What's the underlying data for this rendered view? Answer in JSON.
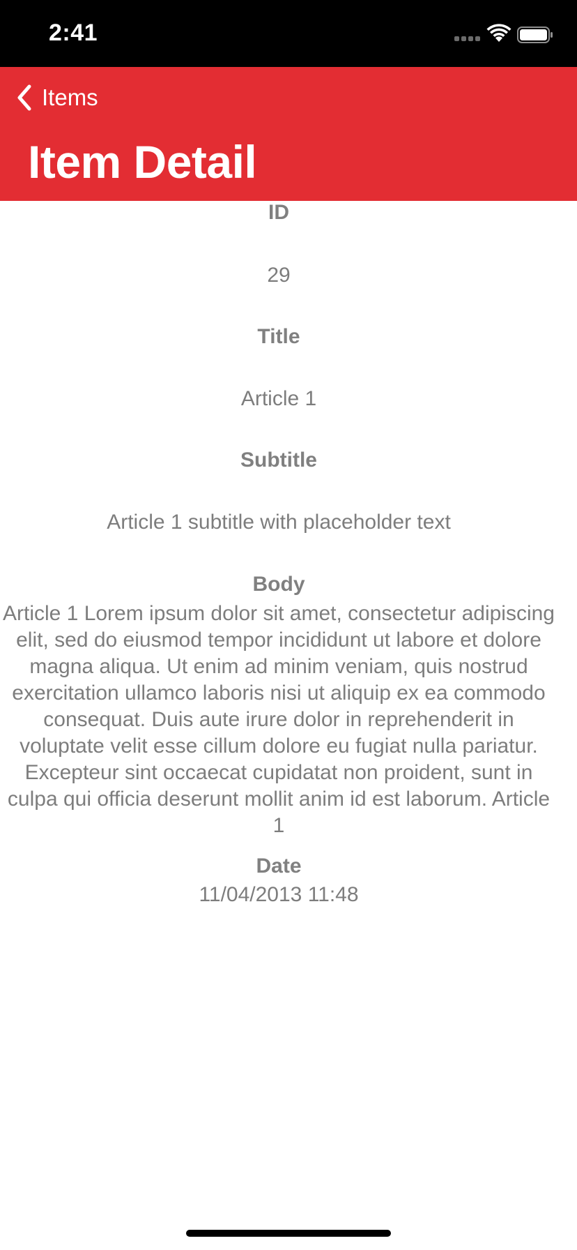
{
  "status_bar": {
    "time": "2:41"
  },
  "nav": {
    "back_label": "Items",
    "title": "Item Detail",
    "color": "#e32d33"
  },
  "fields": {
    "id_label": "ID",
    "id_value": "29",
    "title_label": "Title",
    "title_value": "Article 1",
    "subtitle_label": "Subtitle",
    "subtitle_value": "Article 1 subtitle with placeholder text",
    "body_label": "Body",
    "body_value": "Article 1 Lorem ipsum dolor sit amet, consectetur adipiscing elit, sed do eiusmod tempor incididunt ut labore et dolore magna aliqua. Ut enim ad minim veniam, quis nostrud exercitation ullamco laboris nisi ut aliquip ex ea commodo consequat. Duis aute irure dolor in reprehenderit in voluptate velit esse cillum dolore eu fugiat nulla pariatur. Excepteur sint occaecat cupidatat non proident, sunt in culpa qui officia deserunt mollit anim id est laborum. Article 1",
    "date_label": "Date",
    "date_value": "11/04/2013 11:48"
  },
  "icons": {
    "back": "chevron-left-icon",
    "wifi": "wifi-icon",
    "battery": "battery-icon",
    "cellular": "cellular-signal-icon"
  }
}
